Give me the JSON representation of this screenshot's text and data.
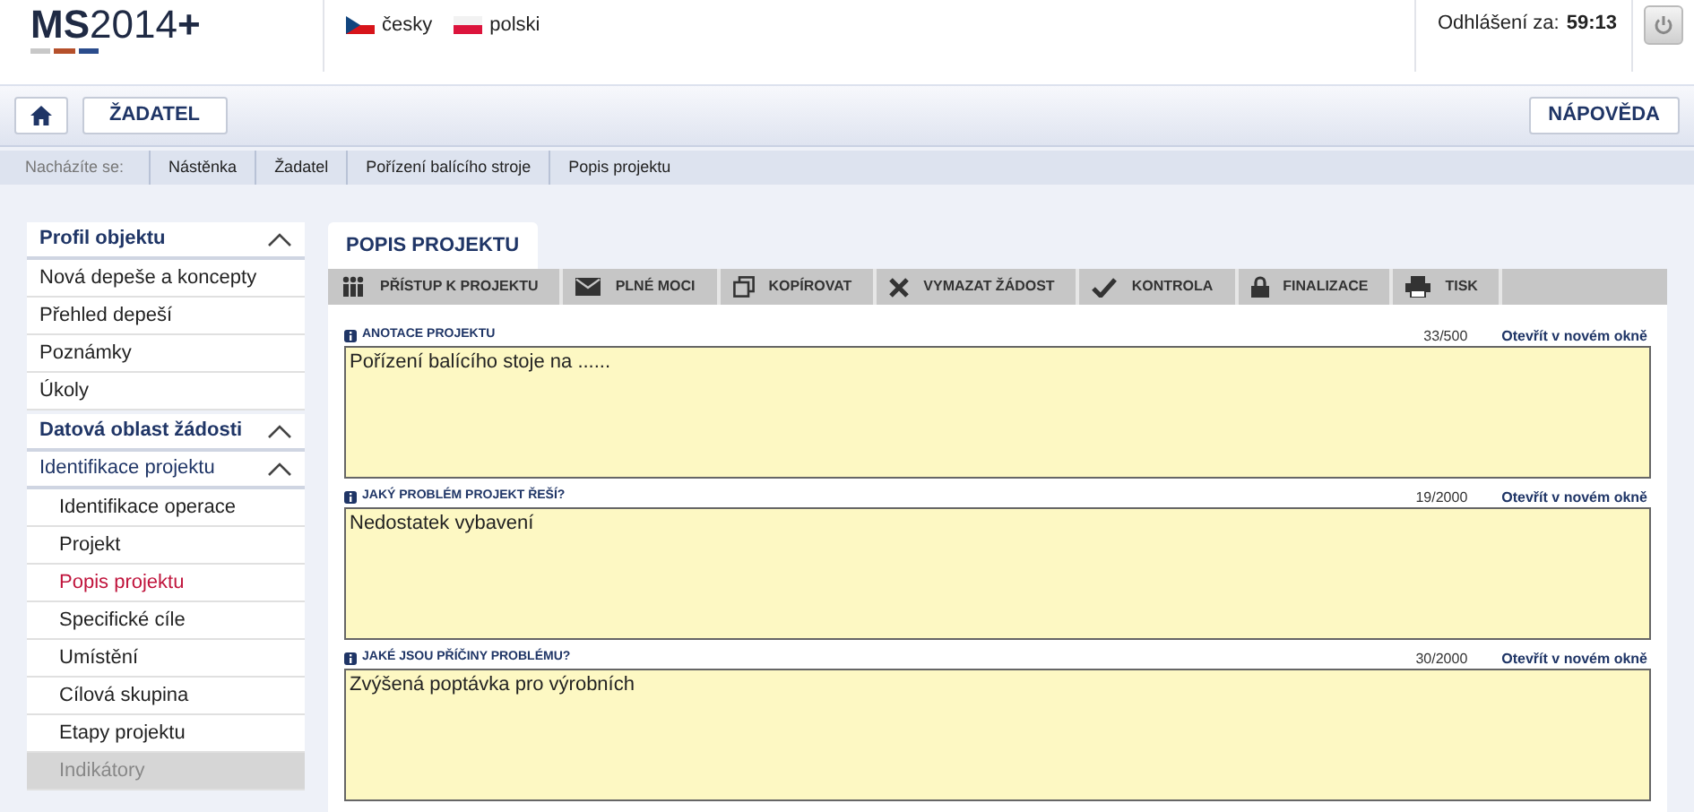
{
  "header": {
    "logo": "**MS**2014**+**",
    "languages": [
      {
        "label": "česky"
      },
      {
        "label": "polski"
      }
    ],
    "logout_label": "Odhlášení za:",
    "logout_time": "59:13"
  },
  "nav": {
    "left_button": "ŽADATEL",
    "right_button": "NÁPOVĚDA"
  },
  "breadcrumb": {
    "label": "Nacházíte se:",
    "items": [
      "Nástěnka",
      "Žadatel",
      "Pořízení balícího stroje",
      "Popis projektu"
    ]
  },
  "sidebar": {
    "items": [
      {
        "kind": "section",
        "label": "Profil objektu",
        "expanded": true
      },
      {
        "kind": "item",
        "label": "Nová depeše a koncepty",
        "selected": false,
        "disabled": false
      },
      {
        "kind": "item",
        "label": "Přehled depeší",
        "selected": false,
        "disabled": false
      },
      {
        "kind": "item",
        "label": "Poznámky",
        "selected": false,
        "disabled": false
      },
      {
        "kind": "item",
        "label": "Úkoly",
        "selected": false,
        "disabled": false
      },
      {
        "kind": "section",
        "label": "Datová oblast žádosti",
        "expanded": true
      },
      {
        "kind": "group",
        "label": "Identifikace projektu",
        "expanded": true,
        "children": [
          {
            "label": "Identifikace operace",
            "selected": false,
            "disabled": false
          },
          {
            "label": "Projekt",
            "selected": false,
            "disabled": false
          },
          {
            "label": "Popis projektu",
            "selected": true,
            "disabled": false
          },
          {
            "label": "Specifické cíle",
            "selected": false,
            "disabled": false
          },
          {
            "label": "Umístění",
            "selected": false,
            "disabled": false
          },
          {
            "label": "Cílová skupina",
            "selected": false,
            "disabled": false
          },
          {
            "label": "Etapy projektu",
            "selected": false,
            "disabled": false
          },
          {
            "label": "Indikátory",
            "selected": false,
            "disabled": true
          }
        ]
      }
    ]
  },
  "tab": {
    "label": "POPIS PROJEKTU"
  },
  "toolbar": [
    {
      "label": "PŘÍSTUP K PROJEKTU"
    },
    {
      "label": "PLNÉ MOCI"
    },
    {
      "label": "KOPÍROVAT"
    },
    {
      "label": "VYMAZAT ŽÁDOST"
    },
    {
      "label": "KONTROLA"
    },
    {
      "label": "FINALIZACE"
    },
    {
      "label": "TISK"
    }
  ],
  "fields": [
    {
      "label": "ANOTACE PROJEKTU",
      "counter": "33/500",
      "link": "Otevřít v novém okně",
      "value": "Pořízení balícího stoje na ......"
    },
    {
      "label": "JAKÝ PROBLÉM PROJEKT ŘEŠÍ?",
      "counter": "19/2000",
      "link": "Otevřít v novém okně",
      "value": "Nedostatek vybavení"
    },
    {
      "label": "JAKÉ JSOU PŘÍČINY PROBLÉMU?",
      "counter": "30/2000",
      "link": "Otevřít v novém okně",
      "value": "Zvýšená poptávka pro výrobních"
    }
  ]
}
